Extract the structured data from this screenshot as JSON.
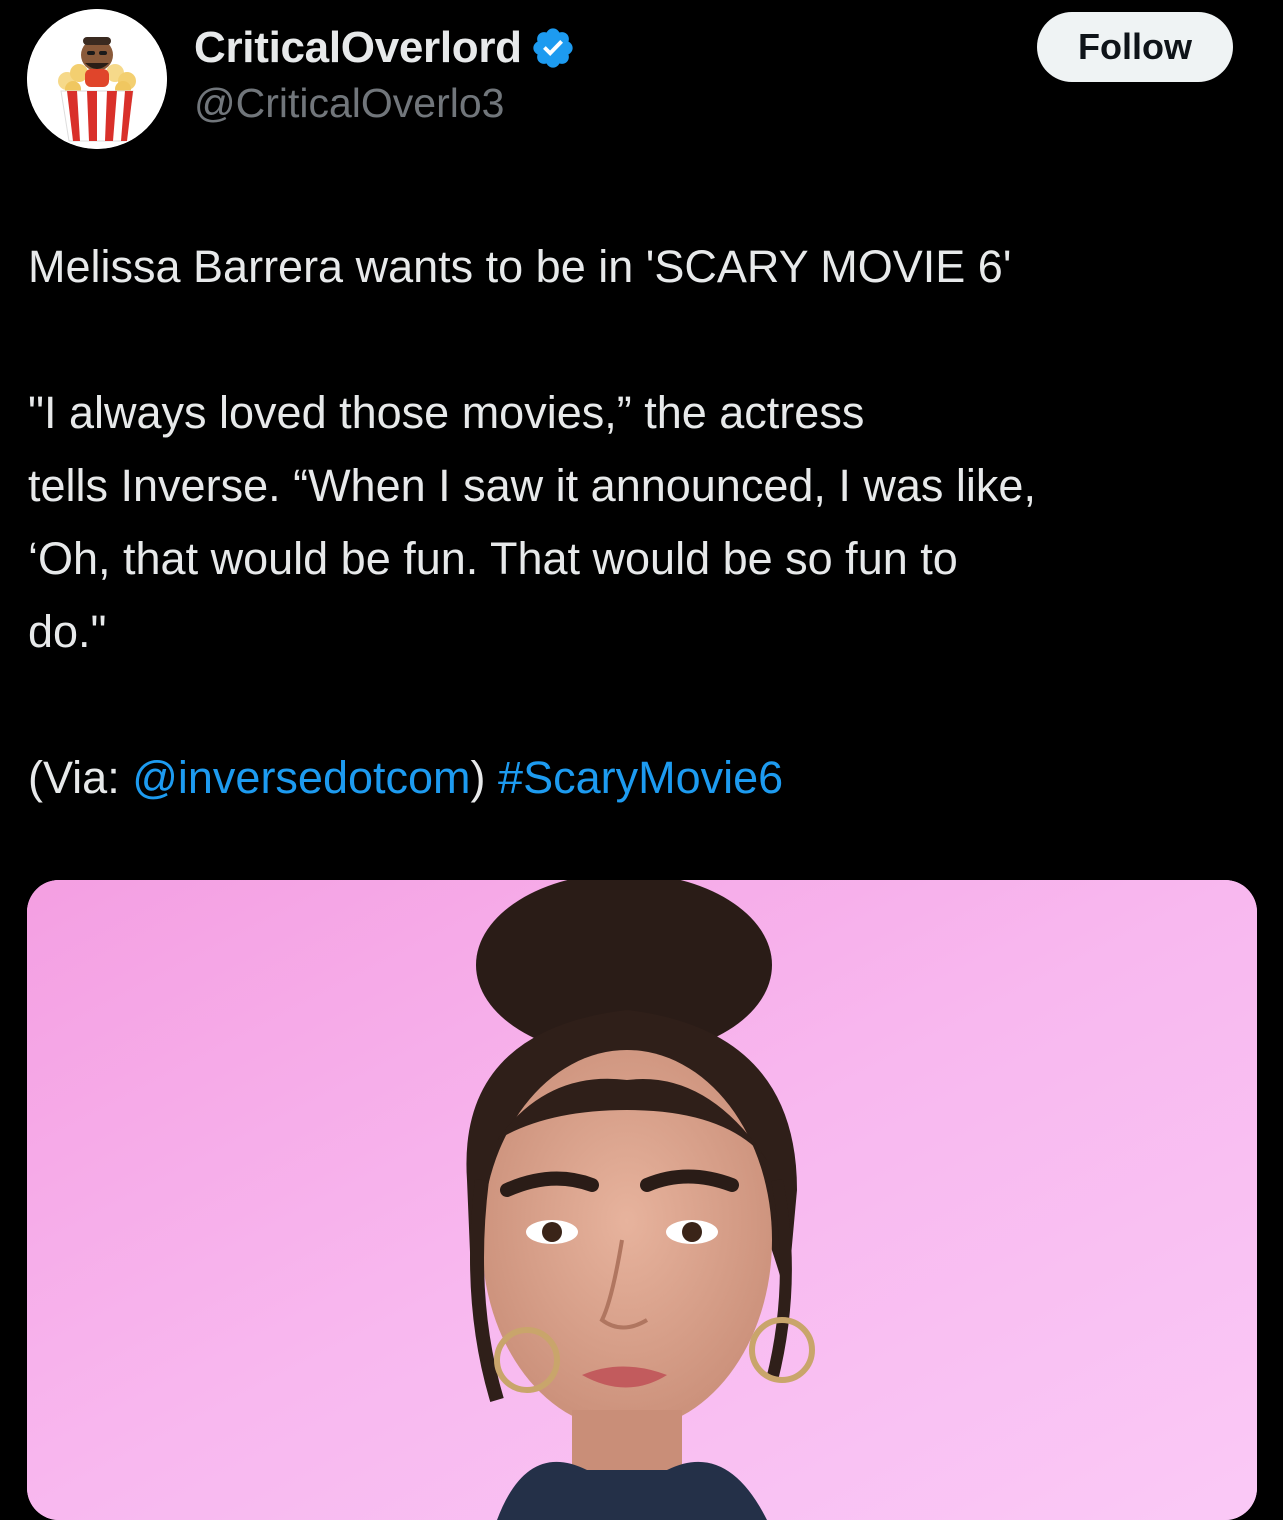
{
  "author": {
    "display_name": "CriticalOverlord",
    "handle": "@CriticalOverlo3",
    "verified": true,
    "avatar_icon": "popcorn-bucket-avatar-icon"
  },
  "actions": {
    "follow_label": "Follow"
  },
  "tweet": {
    "line1": "Melissa Barrera wants to be in 'SCARY MOVIE 6'",
    "quote_line1": "\"I always loved those movies,” the actress",
    "quote_line2": "tells Inverse. “When I saw it announced, I was like,",
    "quote_line3": "‘Oh, that would be fun. That would be so fun to",
    "quote_line4": "do.\"",
    "via_prefix": "(Via: ",
    "mention": "@inversedotcom",
    "via_suffix": ") ",
    "hashtag": "#ScaryMovie6"
  },
  "media": {
    "type": "photo",
    "subject": "woman-portrait-photo"
  },
  "colors": {
    "background": "#000000",
    "text": "#e7e9ea",
    "secondary": "#71767b",
    "link": "#1d9bf0",
    "follow_bg": "#eff3f4",
    "verified_badge": "#1d9bf0",
    "media_bg": "#f8b6ee"
  }
}
